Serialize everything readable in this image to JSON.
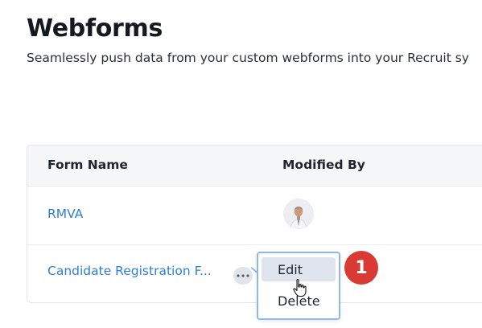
{
  "header": {
    "title": "Webforms",
    "subtitle": "Seamlessly push data from your custom webforms into your Recruit sy"
  },
  "table": {
    "columns": [
      "Form Name",
      "Modified By"
    ],
    "rows": [
      {
        "form_name": "RMVA",
        "modified_by_avatar": "user-avatar"
      },
      {
        "form_name": "Candidate Registration F..."
      }
    ]
  },
  "context_menu": {
    "items": [
      "Edit",
      "Delete"
    ],
    "highlighted": "Edit"
  },
  "annotation": {
    "step_number": "1",
    "color": "#d93a33"
  },
  "colors": {
    "link": "#2f7fd0",
    "header_bg": "#f6f7f9",
    "menu_border": "#8fb8ea",
    "menu_highlight": "#dfe5ee"
  },
  "icons": {
    "row_actions": "more-horizontal-icon",
    "cursor": "hand-pointer-icon"
  }
}
